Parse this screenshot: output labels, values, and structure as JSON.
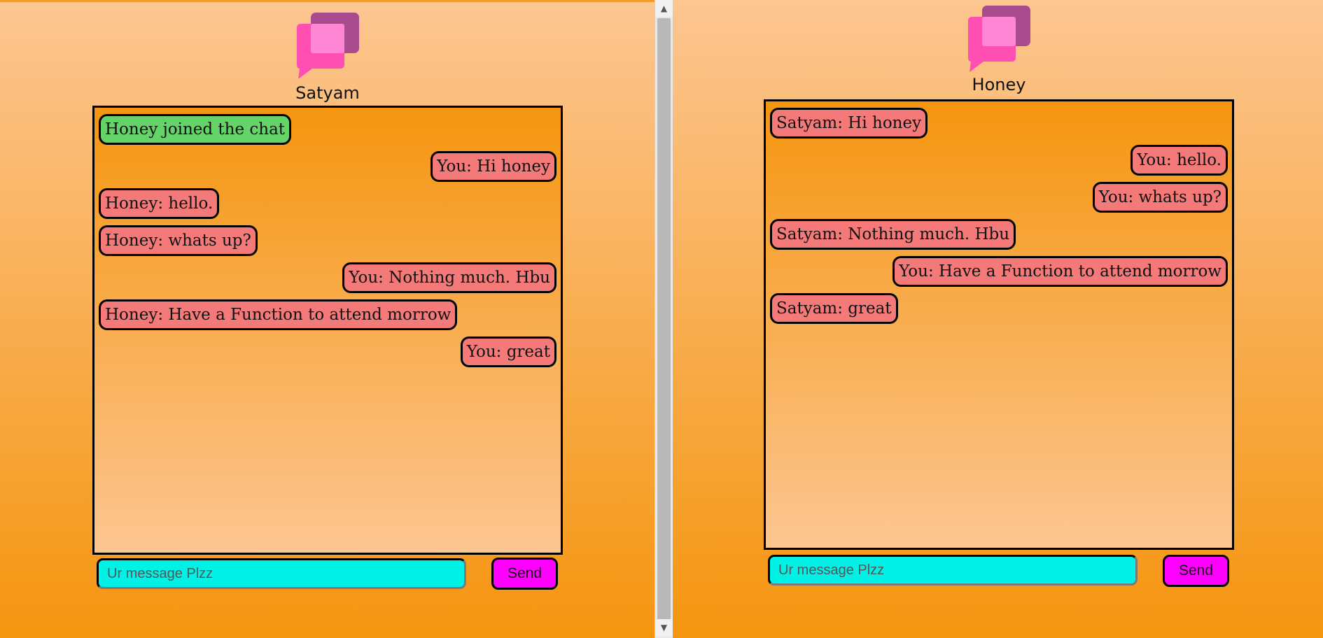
{
  "windows": [
    {
      "username": "Satyam",
      "messages": [
        {
          "text": "Honey joined the chat",
          "side": "left",
          "kind": "system"
        },
        {
          "text": "You: Hi honey",
          "side": "right",
          "kind": "chat"
        },
        {
          "text": "Honey: hello.",
          "side": "left",
          "kind": "chat"
        },
        {
          "text": "Honey: whats up?",
          "side": "left",
          "kind": "chat"
        },
        {
          "text": "You: Nothing much. Hbu",
          "side": "right",
          "kind": "chat"
        },
        {
          "text": "Honey: Have a Function to attend morrow",
          "side": "left",
          "kind": "chat"
        },
        {
          "text": "You: great",
          "side": "right",
          "kind": "chat"
        }
      ],
      "input_placeholder": "Ur message Plzz",
      "input_value": "",
      "send_label": "Send"
    },
    {
      "username": "Honey",
      "messages": [
        {
          "text": "Satyam: Hi honey",
          "side": "left",
          "kind": "chat"
        },
        {
          "text": "You: hello.",
          "side": "right",
          "kind": "chat"
        },
        {
          "text": "You: whats up?",
          "side": "right",
          "kind": "chat"
        },
        {
          "text": "Satyam: Nothing much. Hbu",
          "side": "left",
          "kind": "chat"
        },
        {
          "text": "You: Have a Function to attend morrow",
          "side": "right",
          "kind": "chat"
        },
        {
          "text": "Satyam: great",
          "side": "left",
          "kind": "chat"
        }
      ],
      "input_placeholder": "Ur message Plzz",
      "input_value": "",
      "send_label": "Send"
    }
  ],
  "scrollbar": {
    "up_arrow": "▲",
    "down_arrow": "▼"
  },
  "colors": {
    "background_top": "#fcc691",
    "background_bottom": "#f5950f",
    "bubble": "#f47a7a",
    "system_bubble": "#64d468",
    "input": "#00f2e7",
    "send_button": "#ff00ff",
    "logo_back": "#a94b8f",
    "logo_front": "#ff4fb2",
    "logo_overlap": "#ff86d5"
  }
}
